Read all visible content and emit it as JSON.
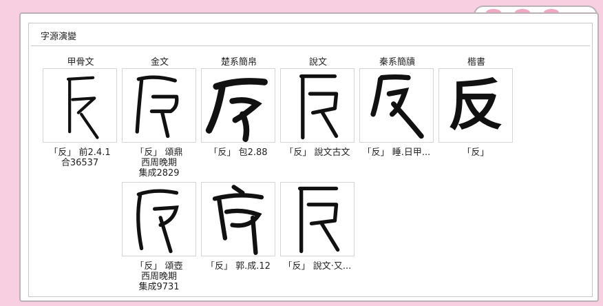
{
  "section": {
    "title": "字源演變"
  },
  "columns": [
    "甲骨文",
    "金文",
    "楚系簡帛",
    "說文",
    "秦系簡牘",
    "楷書"
  ],
  "row1": [
    {
      "lines": [
        "「反」 前2.4.1",
        "合36537"
      ]
    },
    {
      "lines": [
        "「反」 頌鼎",
        "西周晚期",
        "集成2829"
      ]
    },
    {
      "lines": [
        "「反」 包2.88"
      ]
    },
    {
      "lines": [
        "「反」 說文古文"
      ]
    },
    {
      "lines": [
        "「反」 睡.日甲..."
      ]
    },
    {
      "lines": [
        "「反」"
      ]
    }
  ],
  "row2": [
    {
      "lines": [
        "「反」 頌壺",
        "西周晚期",
        "集成9731"
      ]
    },
    {
      "lines": [
        "「反」 郭.成.12"
      ]
    },
    {
      "lines": [
        "「反」 說文·又..."
      ]
    }
  ],
  "kaishu": {
    "char": "反"
  },
  "colors": {
    "background": "#f8cfe0",
    "accent": "#f1a8c3",
    "border": "#b9b1b5"
  }
}
